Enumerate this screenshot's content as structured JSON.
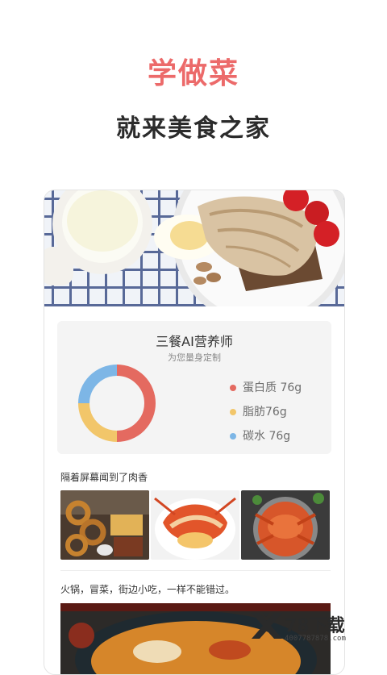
{
  "header": {
    "title": "学做菜",
    "subtitle": "就来美食之家"
  },
  "nutrition": {
    "title": "三餐AI营养师",
    "subtitle": "为您量身定制",
    "legend": [
      {
        "label": "蛋白质 76g",
        "color": "#e46a60"
      },
      {
        "label": "脂肪76g",
        "color": "#f2c66a"
      },
      {
        "label": "碳水 76g",
        "color": "#7db6e6"
      }
    ]
  },
  "chart_data": {
    "type": "pie",
    "categories": [
      "蛋白质",
      "脂肪",
      "碳水"
    ],
    "values": [
      76,
      76,
      76
    ],
    "units": "g",
    "shares": [
      0.5,
      0.25,
      0.25
    ],
    "colors": [
      "#e46a60",
      "#f2c66a",
      "#7db6e6"
    ],
    "donut": true
  },
  "feed": {
    "section1_title": "隔着屏幕闻到了肉香",
    "section2_title": "火锅，冒菜，街边小吃，一样不能错过。"
  },
  "watermark": {
    "brand": "78下载",
    "url": "4007787878.com"
  }
}
